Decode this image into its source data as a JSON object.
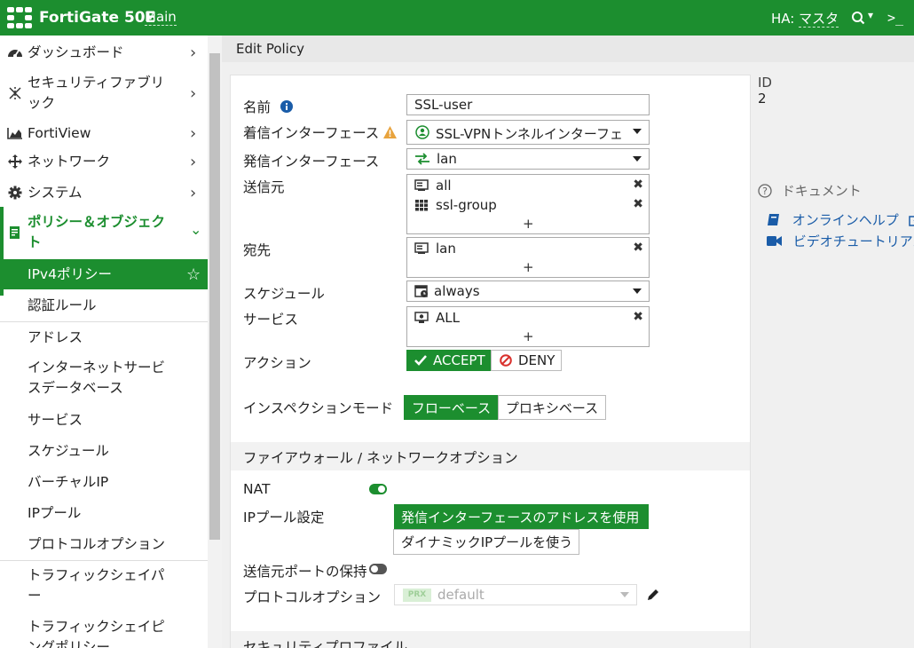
{
  "topbar": {
    "device_name": "FortiGate 50E",
    "vdom": "Main",
    "ha_label": "HA:",
    "ha_value": "マスタ",
    "search_caret": "▾",
    "cli_label": ">_"
  },
  "sidebar": {
    "items": [
      {
        "label": "ダッシュボード",
        "icon": "dashboard-icon",
        "chevron": "›"
      },
      {
        "label": "セキュリティファブリック",
        "icon": "fabric-icon",
        "chevron": "›"
      },
      {
        "label": "FortiView",
        "icon": "chart-icon",
        "chevron": "›"
      },
      {
        "label": "ネットワーク",
        "icon": "network-icon",
        "chevron": "›"
      },
      {
        "label": "システム",
        "icon": "gear-icon",
        "chevron": "›"
      },
      {
        "label": "ポリシー＆オブジェクト",
        "icon": "policy-icon",
        "chevron": "⌄"
      }
    ],
    "sub_items": [
      {
        "label": "IPv4ポリシー"
      },
      {
        "label": "認証ルール"
      },
      {
        "label": "アドレス"
      },
      {
        "label": "インターネットサービスデータベース"
      },
      {
        "label": "サービス"
      },
      {
        "label": "スケジュール"
      },
      {
        "label": "バーチャルIP"
      },
      {
        "label": "IPプール"
      },
      {
        "label": "プロトコルオプション"
      },
      {
        "label": "トラフィックシェイパー"
      },
      {
        "label": "トラフィックシェイピングポリシー"
      }
    ],
    "star": "☆"
  },
  "page": {
    "title": "Edit Policy"
  },
  "form": {
    "name_label": "名前",
    "name_value": "SSL-user",
    "incoming_label": "着信インターフェース",
    "incoming_value": "SSL-VPNトンネルインターフェース",
    "outgoing_label": "発信インターフェース",
    "outgoing_value": "lan",
    "source_label": "送信元",
    "source_entries": [
      "all",
      "ssl-group"
    ],
    "dest_label": "宛先",
    "dest_entries": [
      "lan"
    ],
    "schedule_label": "スケジュール",
    "schedule_value": "always",
    "service_label": "サービス",
    "service_entries": [
      "ALL"
    ],
    "action_label": "アクション",
    "action_accept": "ACCEPT",
    "action_deny": "DENY",
    "inspection_label": "インスペクションモード",
    "inspection_flow": "フローベース",
    "inspection_proxy": "プロキシベース",
    "remove_glyph": "✖",
    "add_glyph": "+"
  },
  "firewall_section": {
    "title": "ファイアウォール / ネットワークオプション",
    "nat_label": "NAT",
    "nat_enabled": true,
    "ippool_label": "IPプール設定",
    "ippool_use_outgoing": "発信インターフェースのアドレスを使用",
    "ippool_dynamic": "ダイナミックIPプールを使う",
    "preserve_port_label": "送信元ポートの保持",
    "preserve_port_enabled": false,
    "protocol_label": "プロトコルオプション",
    "protocol_badge": "PRX",
    "protocol_value": "default"
  },
  "security_section": {
    "title": "セキュリティプロファイル"
  },
  "right_panel": {
    "id_label": "ID",
    "id_value": "2",
    "docs_label": "ドキュメント",
    "online_help": "オンラインヘルプ",
    "video_tutorials": "ビデオチュートリアル"
  },
  "colors": {
    "brand_green": "#1c8e2f",
    "link_blue": "#1a5ca8",
    "warning_orange": "#e8a33d",
    "deny_red": "#d9302c"
  }
}
